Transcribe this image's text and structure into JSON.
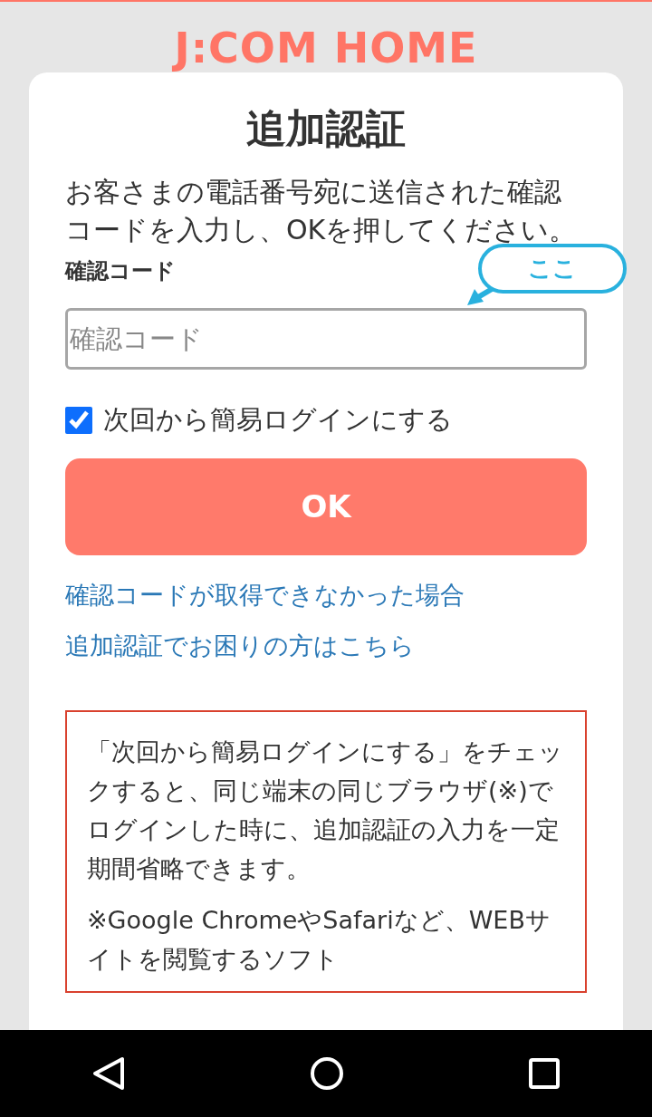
{
  "logo": "J:COM HOME",
  "title": "追加認証",
  "instructions": "お客さまの電話番号宛に送信された確認コードを入力し、OKを押してください。",
  "code_field": {
    "label": "確認コード",
    "placeholder": "確認コード"
  },
  "callout": "ここ",
  "remember": {
    "label": "次回から簡易ログインにする",
    "checked": true
  },
  "ok_button": "OK",
  "links": [
    "確認コードが取得できなかった場合",
    "追加認証でお困りの方はこちら"
  ],
  "notice": [
    "「次回から簡易ログインにする」をチェックすると、同じ端末の同じブラウザ(※)でログインした時に、追加認証の入力を一定期間省略できます。",
    "※Google ChromeやSafariなど、WEBサイトを閲覧するソフト"
  ]
}
